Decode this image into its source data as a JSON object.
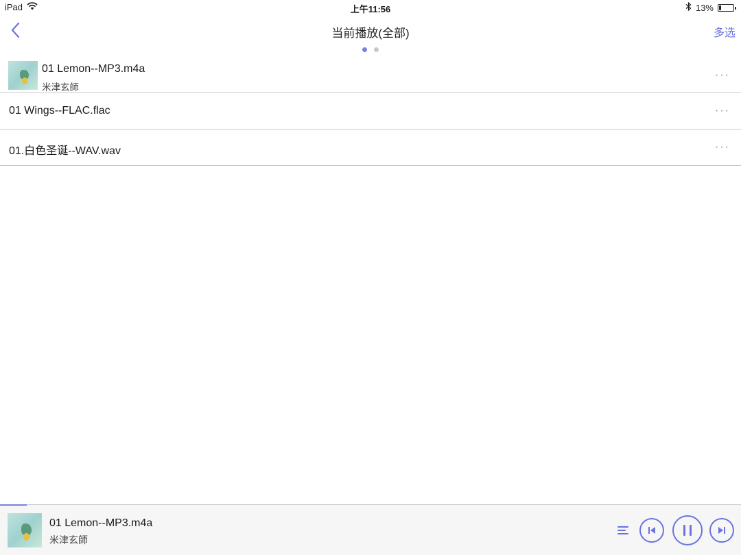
{
  "status_bar": {
    "device": "iPad",
    "time": "上午11:56",
    "battery_percent": "13%",
    "battery_level": 0.13,
    "icons": [
      "wifi-icon",
      "bluetooth-icon",
      "battery-icon"
    ]
  },
  "nav": {
    "title": "当前播放(全部)",
    "multi_select": "多选",
    "back_icon": "chevron-left-icon",
    "page_count": 2,
    "active_page": 1
  },
  "tracks": [
    {
      "title": "01 Lemon--MP3.m4a",
      "artist": "米津玄師",
      "has_artwork": true
    },
    {
      "title": "01 Wings--FLAC.flac",
      "artist": "",
      "has_artwork": false
    },
    {
      "title": "01.白色圣诞--WAV.wav",
      "artist": "",
      "has_artwork": false
    }
  ],
  "now_playing": {
    "title": "01 Lemon--MP3.m4a",
    "artist": "米津玄師",
    "progress": 0.036,
    "controls": [
      "queue-icon",
      "previous-icon",
      "pause-icon",
      "next-icon"
    ]
  },
  "colors": {
    "accent": "#6a72e0",
    "divider": "#c8c8cc",
    "player_bg": "#f6f6f7"
  }
}
